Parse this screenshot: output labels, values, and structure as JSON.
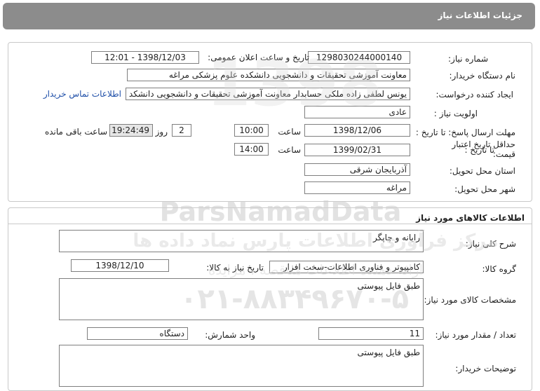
{
  "header": {
    "title": "جزئیات اطلاعات نیاز"
  },
  "info": {
    "need_number_label": "شماره نیاز:",
    "need_number": "1298030244000140",
    "announce_label": "تاریخ و ساعت اعلان عمومی:",
    "announce_value": "1398/12/03 - 12:01",
    "buyer_label": "نام دستگاه خریدار:",
    "buyer_value": "معاونت آموزشی تحقیقات و دانشجویی دانشکده علوم پزشکی مراغه",
    "creator_label": "ایجاد کننده درخواست:",
    "creator_value": "یونس لطفی زاده ملکی حسابدار معاونت آموزشی تحقیقات و دانشجویی دانشکد",
    "contact_link": "اطلاعات تماس خریدار",
    "priority_label": "اولویت نیاز :",
    "priority_value": "عادی",
    "deadline_label": "مهلت ارسال پاسخ:  تا تاریخ :",
    "deadline_date": "1398/12/06",
    "time_label": "ساعت",
    "deadline_time": "10:00",
    "days_value": "2",
    "days_label": "روز و",
    "remaining_time": "19:24:49",
    "remaining_label": "ساعت باقی مانده",
    "validity_label": "حداقل تاریخ اعتبار قیمت:",
    "validity_to": "تا تاریخ :",
    "validity_date": "1399/02/31",
    "validity_time": "14:00",
    "province_label": "استان محل تحویل:",
    "province_value": "آذربایجان شرقی",
    "city_label": "شهر محل تحویل:",
    "city_value": "مراغه"
  },
  "goods": {
    "section_title": "اطلاعات کالاهای مورد نیاز",
    "summary_label": "شرح کلی نیاز:",
    "summary_value": "رایانه و چاپگر",
    "group_label": "گروه کالا:",
    "group_value": "کامپیوتر و فناوری اطلاعات-سخت افزار",
    "need_date_label": "تاریخ نیاز به کالا:",
    "need_date_value": "1398/12/10",
    "spec_label": "مشخصات کالای مورد نیاز:",
    "spec_value": "طبق فایل پیوستی",
    "qty_label": "تعداد / مقدار مورد نیاز:",
    "qty_value": "11",
    "unit_label": "واحد شمارش:",
    "unit_value": "دستگاه",
    "buyer_notes_label": "توضیحات خریدار:",
    "buyer_notes_value": "طبق فایل پیوستی"
  },
  "watermark": {
    "brand": "ParsNamadData",
    "line1": "مرکز فرآوری اطلاعات پارس نماد داده ها",
    "line2": "ارائه دهنده اطلاعات مناقصه ، مزایده",
    "phone": "۰۲۱-۸۸۳۴۹۶۷۰-۵",
    "digits": "1398"
  }
}
